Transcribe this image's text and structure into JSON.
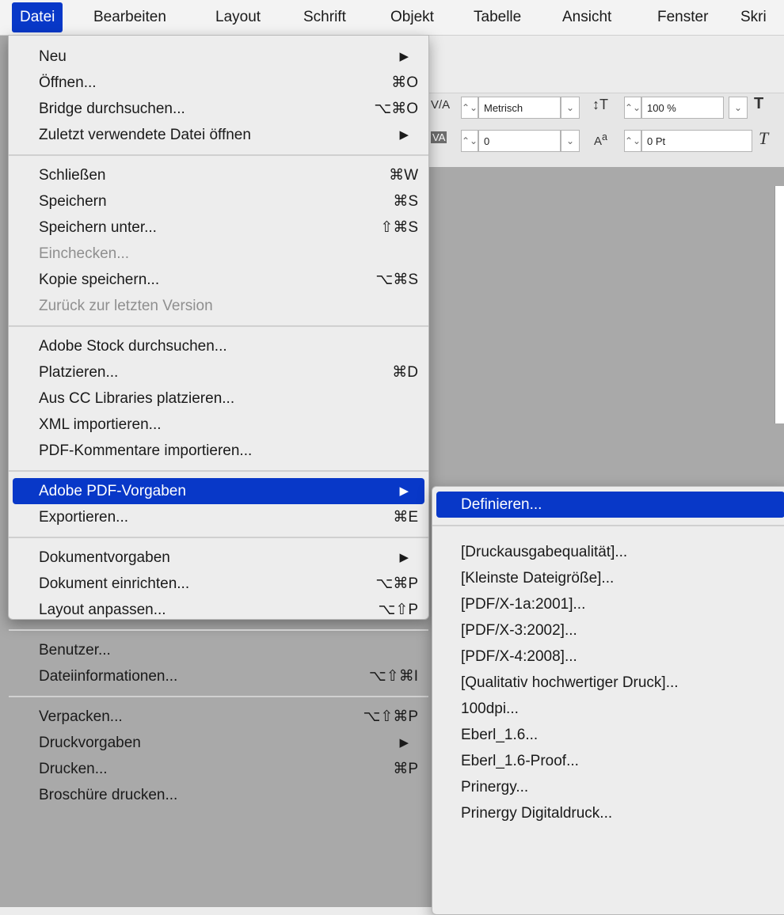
{
  "menubar": {
    "items": [
      "Datei",
      "Bearbeiten",
      "Layout",
      "Schrift",
      "Objekt",
      "Tabelle",
      "Ansicht",
      "Fenster",
      "Skri"
    ]
  },
  "toolbar": {
    "tracking_value": "Metrisch",
    "scale_value": "100 %",
    "kerning_value": "0",
    "baseline_value": "0 Pt"
  },
  "file_menu": {
    "groups": [
      [
        {
          "label": "Neu",
          "shortcut": "",
          "submenu": true
        },
        {
          "label": "Öffnen...",
          "shortcut": "⌘O"
        },
        {
          "label": "Bridge durchsuchen...",
          "shortcut": "⌥⌘O"
        },
        {
          "label": "Zuletzt verwendete Datei öffnen",
          "shortcut": "",
          "submenu": true
        }
      ],
      [
        {
          "label": "Schließen",
          "shortcut": "⌘W"
        },
        {
          "label": "Speichern",
          "shortcut": "⌘S"
        },
        {
          "label": "Speichern unter...",
          "shortcut": "⇧⌘S"
        },
        {
          "label": "Einchecken...",
          "shortcut": "",
          "disabled": true
        },
        {
          "label": "Kopie speichern...",
          "shortcut": "⌥⌘S"
        },
        {
          "label": "Zurück zur letzten Version",
          "shortcut": "",
          "disabled": true
        }
      ],
      [
        {
          "label": "Adobe Stock durchsuchen...",
          "shortcut": ""
        },
        {
          "label": "Platzieren...",
          "shortcut": "⌘D"
        },
        {
          "label": "Aus CC Libraries platzieren...",
          "shortcut": ""
        },
        {
          "label": "XML importieren...",
          "shortcut": ""
        },
        {
          "label": "PDF-Kommentare importieren...",
          "shortcut": ""
        }
      ],
      [
        {
          "label": "Adobe PDF-Vorgaben",
          "shortcut": "",
          "submenu": true,
          "highlighted": true
        },
        {
          "label": "Exportieren...",
          "shortcut": "⌘E"
        }
      ],
      [
        {
          "label": "Dokumentvorgaben",
          "shortcut": "",
          "submenu": true
        },
        {
          "label": "Dokument einrichten...",
          "shortcut": "⌥⌘P"
        },
        {
          "label": "Layout anpassen...",
          "shortcut": "⌥⇧P"
        }
      ],
      [
        {
          "label": "Benutzer...",
          "shortcut": ""
        },
        {
          "label": "Dateiinformationen...",
          "shortcut": "⌥⇧⌘I"
        }
      ],
      [
        {
          "label": "Verpacken...",
          "shortcut": "⌥⇧⌘P"
        },
        {
          "label": "Druckvorgaben",
          "shortcut": "",
          "submenu": true
        },
        {
          "label": "Drucken...",
          "shortcut": "⌘P"
        },
        {
          "label": "Broschüre drucken...",
          "shortcut": ""
        }
      ]
    ]
  },
  "pdf_submenu": {
    "define": "Definieren...",
    "presets": [
      "[Druckausgabequalität]...",
      "[Kleinste Dateigröße]...",
      "[PDF/X-1a:2001]...",
      "[PDF/X-3:2002]...",
      "[PDF/X-4:2008]...",
      "[Qualitativ hochwertiger Druck]...",
      "100dpi...",
      "Eberl_1.6...",
      "Eberl_1.6-Proof...",
      "Prinergy...",
      "Prinergy Digitaldruck..."
    ]
  },
  "colors": {
    "highlight": "#0838c8",
    "disabled_text": "#8f8f8f"
  }
}
